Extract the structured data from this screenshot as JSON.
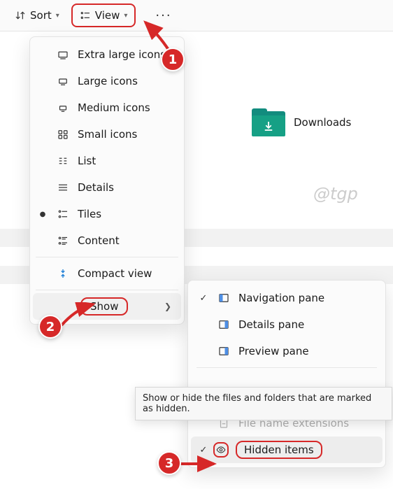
{
  "toolbar": {
    "sort_label": "Sort",
    "view_label": "View"
  },
  "folder": {
    "name": "Downloads"
  },
  "watermark": "@tgp",
  "view_menu": {
    "items": [
      {
        "label": "Extra large icons"
      },
      {
        "label": "Large icons"
      },
      {
        "label": "Medium icons"
      },
      {
        "label": "Small icons"
      },
      {
        "label": "List"
      },
      {
        "label": "Details"
      },
      {
        "label": "Tiles"
      },
      {
        "label": "Content"
      }
    ],
    "compact": "Compact view",
    "show": "Show"
  },
  "show_submenu": {
    "nav": "Navigation pane",
    "details": "Details pane",
    "preview": "Preview pane",
    "ext": "File name extensions",
    "hidden": "Hidden items"
  },
  "tooltip": {
    "text": "Show or hide the files and folders that are marked as hidden."
  },
  "callouts": {
    "c1": "1",
    "c2": "2",
    "c3": "3"
  }
}
